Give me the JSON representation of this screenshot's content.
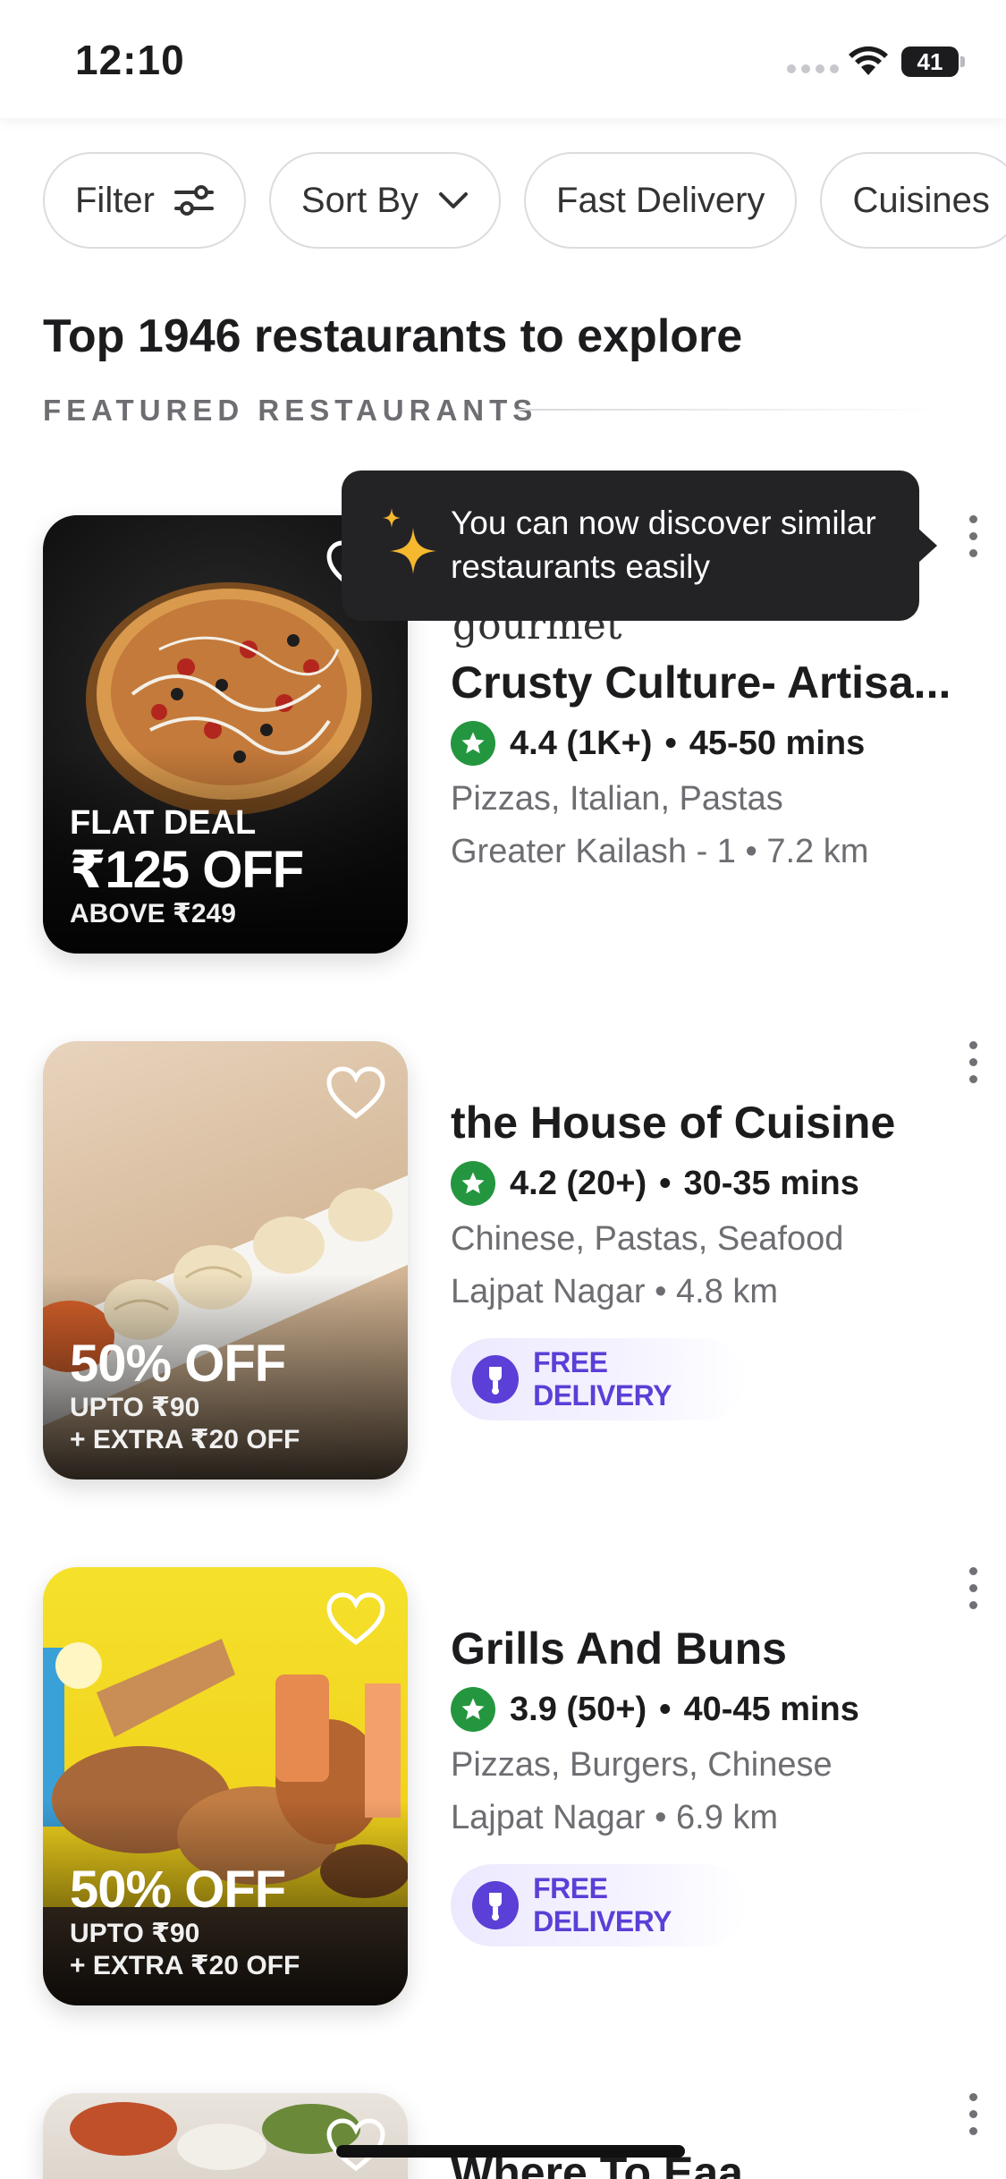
{
  "status_bar": {
    "time": "12:10",
    "battery": "41"
  },
  "chips": [
    {
      "label": "Filter",
      "icon": "sliders-icon"
    },
    {
      "label": "Sort By",
      "icon": "chevron-down-icon"
    },
    {
      "label": "Fast Delivery"
    },
    {
      "label": "Cuisines"
    }
  ],
  "section": {
    "title": "Top 1946 restaurants to explore",
    "subtitle": "FEATURED RESTAURANTS"
  },
  "tooltip": {
    "text": "You can now discover similar restaurants easily",
    "icon": "sparkle-icon"
  },
  "restaurants": [
    {
      "brand_text": "gourmet",
      "name": "Crusty Culture- Artisa...",
      "rating": "4.4 (1K+)",
      "time": "45-50 mins",
      "cuisines": "Pizzas, Italian, Pastas",
      "location": "Greater Kailash - 1 • 7.2 km",
      "offer": {
        "label": "FLAT DEAL",
        "main": "₹125 OFF",
        "line1": "ABOVE ₹249",
        "line2": ""
      },
      "free_delivery": ""
    },
    {
      "name": "the House of Cuisine",
      "rating": "4.2 (20+)",
      "time": "30-35 mins",
      "cuisines": "Chinese, Pastas, Seafood",
      "location": "Lajpat Nagar • 4.8 km",
      "offer": {
        "label": "",
        "main": "50% OFF",
        "line1": "UPTO ₹90",
        "line2": "+ EXTRA ₹20 OFF"
      },
      "free_delivery": "FREE DELIVERY"
    },
    {
      "name": "Grills And Buns",
      "rating": "3.9 (50+)",
      "time": "40-45 mins",
      "cuisines": "Pizzas, Burgers, Chinese",
      "location": "Lajpat Nagar • 6.9 km",
      "offer": {
        "label": "",
        "main": "50% OFF",
        "line1": "UPTO ₹90",
        "line2": "+ EXTRA ₹20 OFF"
      },
      "free_delivery": "FREE DELIVERY"
    },
    {
      "name": "Where To Eaa"
    }
  ],
  "colors": {
    "rating_green": "#24963f",
    "free_delivery_purple": "#5b3fd6"
  }
}
